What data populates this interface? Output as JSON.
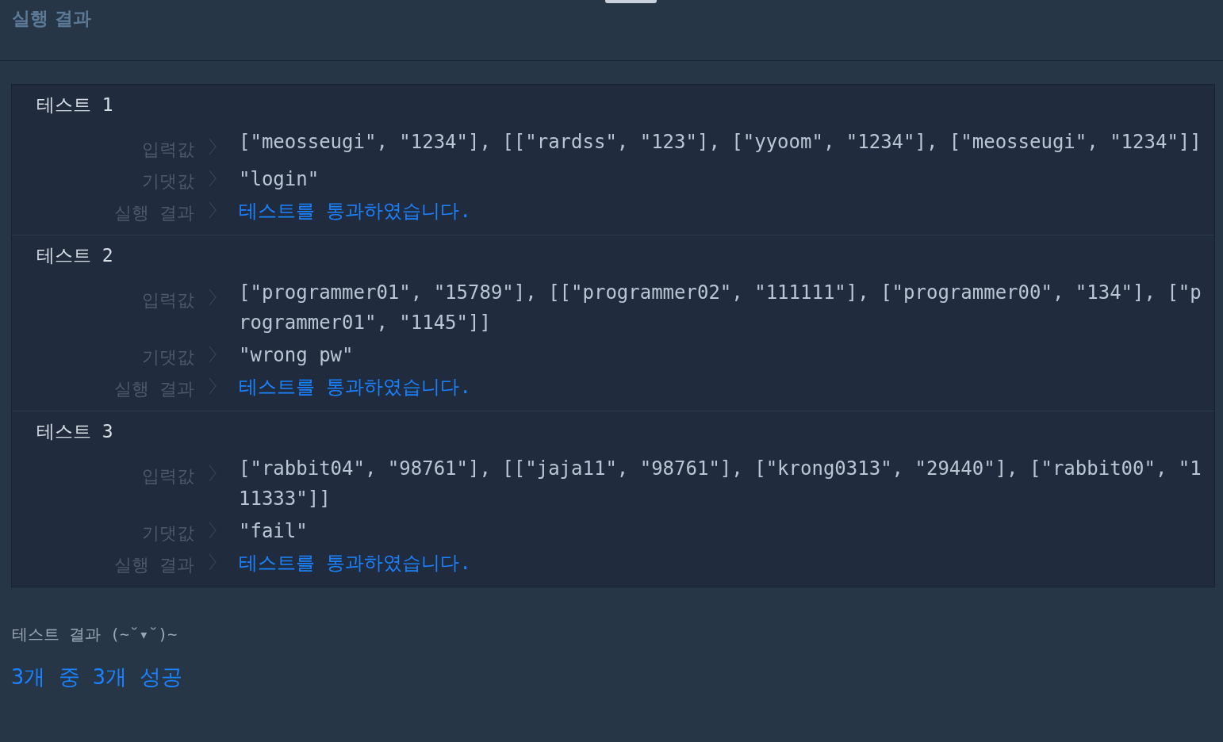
{
  "header": {
    "title": "실행 결과"
  },
  "tests": [
    {
      "title": "테스트 1",
      "input_label": "입력값",
      "input": "[\"meosseugi\", \"1234\"], [[\"rardss\", \"123\"], [\"yyoom\", \"1234\"], [\"meosseugi\", \"1234\"]]",
      "expected_label": "기댓값",
      "expected": "\"login\"",
      "result_label": "실행 결과",
      "result": "테스트를 통과하였습니다.",
      "passed": true
    },
    {
      "title": "테스트 2",
      "input_label": "입력값",
      "input": "[\"programmer01\", \"15789\"], [[\"programmer02\", \"111111\"], [\"programmer00\", \"134\"], [\"programmer01\", \"1145\"]]",
      "expected_label": "기댓값",
      "expected": "\"wrong pw\"",
      "result_label": "실행 결과",
      "result": "테스트를 통과하였습니다.",
      "passed": true
    },
    {
      "title": "테스트 3",
      "input_label": "입력값",
      "input": "[\"rabbit04\", \"98761\"], [[\"jaja11\", \"98761\"], [\"krong0313\", \"29440\"], [\"rabbit00\", \"111333\"]]",
      "expected_label": "기댓값",
      "expected": "\"fail\"",
      "result_label": "실행 결과",
      "result": "테스트를 통과하였습니다.",
      "passed": true
    }
  ],
  "summary": {
    "heading": "테스트 결과 (~˘▾˘)~",
    "result": "3개 중 3개 성공"
  }
}
